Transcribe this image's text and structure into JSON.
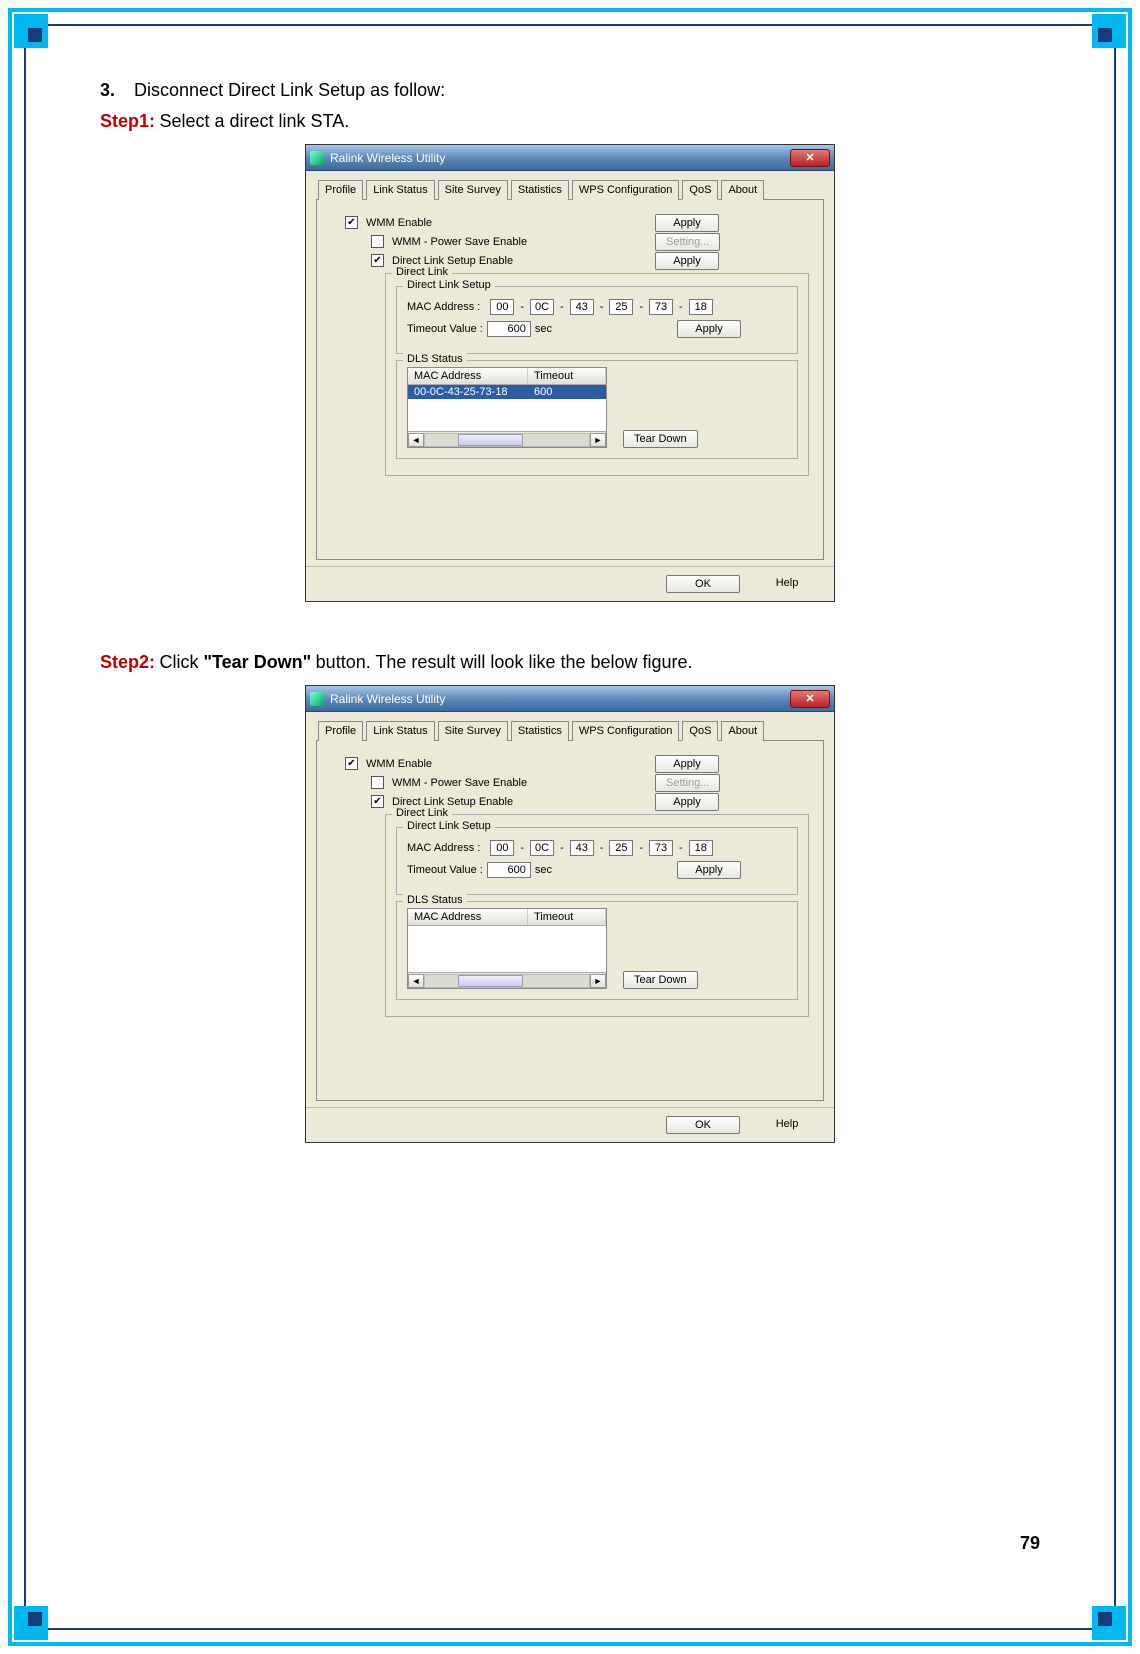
{
  "page_number": "79",
  "list": {
    "num": "3.",
    "text": "Disconnect Direct Link Setup as follow:"
  },
  "step1": {
    "label": "Step1:",
    "text": " Select a direct link STA."
  },
  "step2": {
    "label": "Step2:",
    "text_before": " Click ",
    "emphasis": "\"Tear Down\"",
    "text_after": " button. The result will look like the below figure."
  },
  "dialog1": {
    "title": "Ralink Wireless Utility",
    "tabs": [
      "Profile",
      "Link Status",
      "Site Survey",
      "Statistics",
      "WPS Configuration",
      "QoS",
      "About"
    ],
    "active_tab": "QoS",
    "wmm_enable": "WMM Enable",
    "wmm_ps": "WMM - Power Save Enable",
    "dls_enable": "Direct Link Setup Enable",
    "btn_apply": "Apply",
    "btn_setting": "Setting...",
    "fs_direct_link": "Direct Link",
    "fs_dls_setup": "Direct Link Setup",
    "mac_label": "MAC Address :",
    "mac": [
      "00",
      "0C",
      "43",
      "25",
      "73",
      "18"
    ],
    "timeout_label": "Timeout Value :",
    "timeout_value": "600",
    "timeout_unit": "sec",
    "fs_dls_status": "DLS Status",
    "col_mac": "MAC Address",
    "col_timeout": "Timeout",
    "row_mac": "00-0C-43-25-73-18",
    "row_timeout": "600",
    "btn_teardown": "Tear Down",
    "btn_ok": "OK",
    "btn_help": "Help"
  },
  "dialog2": {
    "title": "Ralink Wireless Utility",
    "tabs": [
      "Profile",
      "Link Status",
      "Site Survey",
      "Statistics",
      "WPS Configuration",
      "QoS",
      "About"
    ],
    "active_tab": "QoS",
    "wmm_enable": "WMM Enable",
    "wmm_ps": "WMM - Power Save Enable",
    "dls_enable": "Direct Link Setup Enable",
    "btn_apply": "Apply",
    "btn_setting": "Setting...",
    "fs_direct_link": "Direct Link",
    "fs_dls_setup": "Direct Link Setup",
    "mac_label": "MAC Address :",
    "mac": [
      "00",
      "0C",
      "43",
      "25",
      "73",
      "18"
    ],
    "timeout_label": "Timeout Value :",
    "timeout_value": "600",
    "timeout_unit": "sec",
    "fs_dls_status": "DLS Status",
    "col_mac": "MAC Address",
    "col_timeout": "Timeout",
    "btn_teardown": "Tear Down",
    "btn_ok": "OK",
    "btn_help": "Help"
  }
}
